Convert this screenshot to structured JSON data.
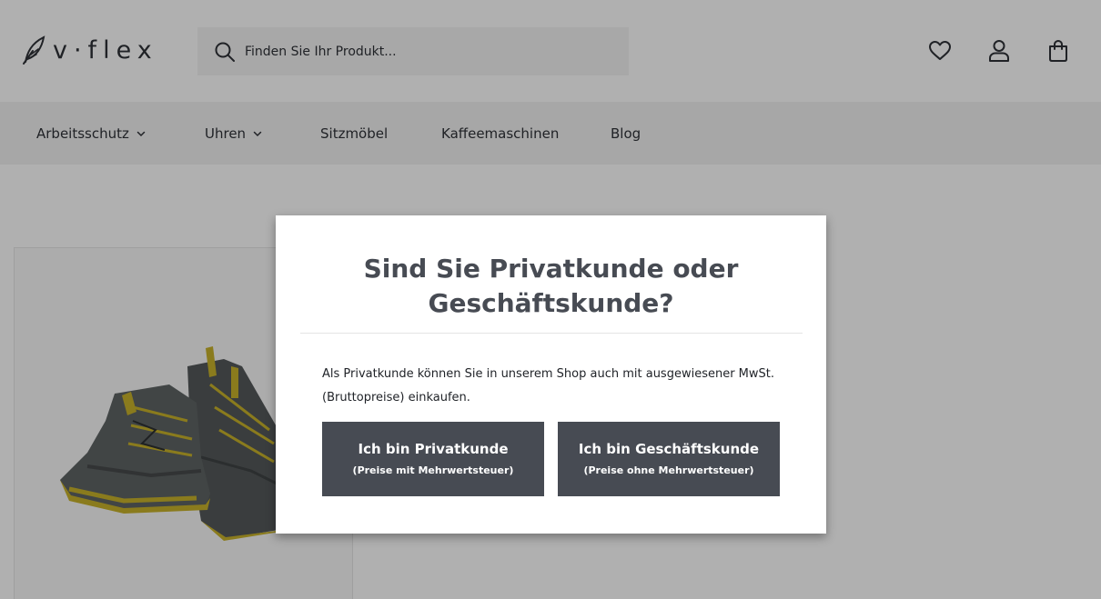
{
  "header": {
    "logo_text": "v·flex",
    "search_placeholder": "Finden Sie Ihr Produkt..."
  },
  "nav": {
    "items": [
      {
        "label": "Arbeitsschutz",
        "has_dropdown": true
      },
      {
        "label": "Uhren",
        "has_dropdown": true
      },
      {
        "label": "Sitzmöbel",
        "has_dropdown": false
      },
      {
        "label": "Kaffeemaschinen",
        "has_dropdown": false
      },
      {
        "label": "Blog",
        "has_dropdown": false
      }
    ]
  },
  "icons": {
    "wishlist": "heart-icon",
    "account": "user-icon",
    "cart": "shopping-bag-icon",
    "search": "search-icon",
    "logo": "feather-icon"
  },
  "modal": {
    "title_line1": "Sind Sie Privatkunde oder",
    "title_line2": "Geschäftskunde?",
    "text": "Als Privatkunde können Sie in unserem Shop auch mit ausgewiesener MwSt. (Bruttopreise) einkaufen.",
    "buttons": [
      {
        "label": "Ich bin Privatkunde",
        "sublabel": "(Preise mit Mehrwertsteuer)"
      },
      {
        "label": "Ich bin Geschäftskunde",
        "sublabel": "(Preise ohne Mehrwertsteuer)"
      }
    ]
  },
  "colors": {
    "overlay": "#000000",
    "button_bg": "#474b53",
    "text_dark": "#2f3238",
    "shoe_body": "#5a5f60",
    "shoe_accent": "#c9b32a"
  }
}
